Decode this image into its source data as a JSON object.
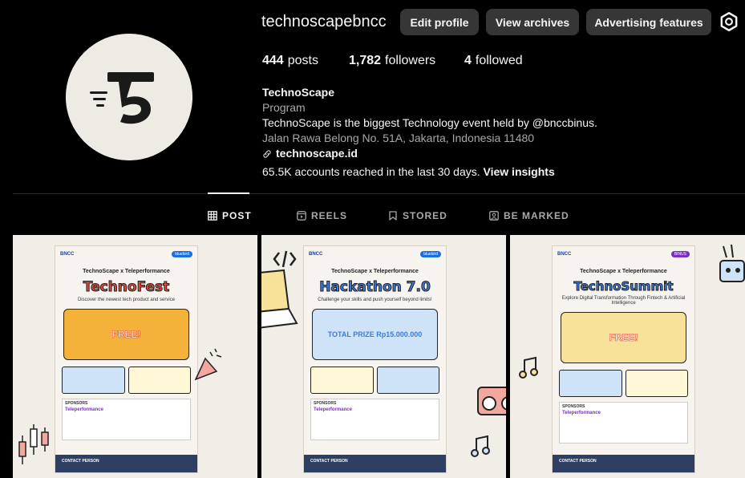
{
  "profile": {
    "username": "technoscapebncc",
    "avatar_text": "TechnoScape",
    "buttons": {
      "edit": "Edit profile",
      "archives": "View archives",
      "ads": "Advertising features"
    },
    "stats": {
      "posts_count": "444",
      "posts_label": "posts",
      "followers_count": "1,782",
      "followers_label": "followers",
      "followed_count": "4",
      "followed_label": "followed"
    },
    "bio": {
      "name": "TechnoScape",
      "category": "Program",
      "description": "TechnoScape is the biggest Technology event held by @bnccbinus.",
      "address": "Jalan Rawa Belong No. 51A, Jakarta, Indonesia 11480",
      "link": "technoscape.id"
    },
    "insights": {
      "text": "65.5K accounts reached in the last 30 days.",
      "link": "View insights"
    }
  },
  "tabs": [
    {
      "label": "POST",
      "icon": "grid-icon",
      "active": true
    },
    {
      "label": "REELS",
      "icon": "reels-icon",
      "active": false
    },
    {
      "label": "STORED",
      "icon": "bookmark-icon",
      "active": false
    },
    {
      "label": "BE MARKED",
      "icon": "tagged-icon",
      "active": false
    }
  ],
  "posts": [
    {
      "title": "TechnoFest",
      "subtitle": "Discover the newest tech product and service",
      "badge": "FREE!",
      "collab": "TechnoScape x Teleperformance",
      "sponsor_header": "SPONSORS",
      "sponsor_name": "Teleperformance",
      "contact": "CONTACT PERSON"
    },
    {
      "title": "Hackathon 7.0",
      "subtitle": "Challenge your skills and push yourself beyond limits!",
      "badge": "TOTAL PRIZE Rp15.000.000",
      "collab": "TechnoScape x Teleperformance",
      "sponsor_header": "SPONSORS",
      "sponsor_name": "Teleperformance",
      "contact": "CONTACT PERSON"
    },
    {
      "title": "TechnoSummit",
      "subtitle": "Explore Digital Transformation Through Fintech & Artificial Intelligence",
      "badge": "FREE!",
      "collab": "TechnoScape x Teleperformance",
      "sponsor_header": "SPONSORS",
      "sponsor_name": "Teleperformance",
      "contact": "CONTACT PERSON"
    }
  ],
  "colors": {
    "background": "#000000",
    "button_bg": "#363636",
    "muted_text": "#a8a8a8",
    "tile_bg": "#f1ede7"
  }
}
